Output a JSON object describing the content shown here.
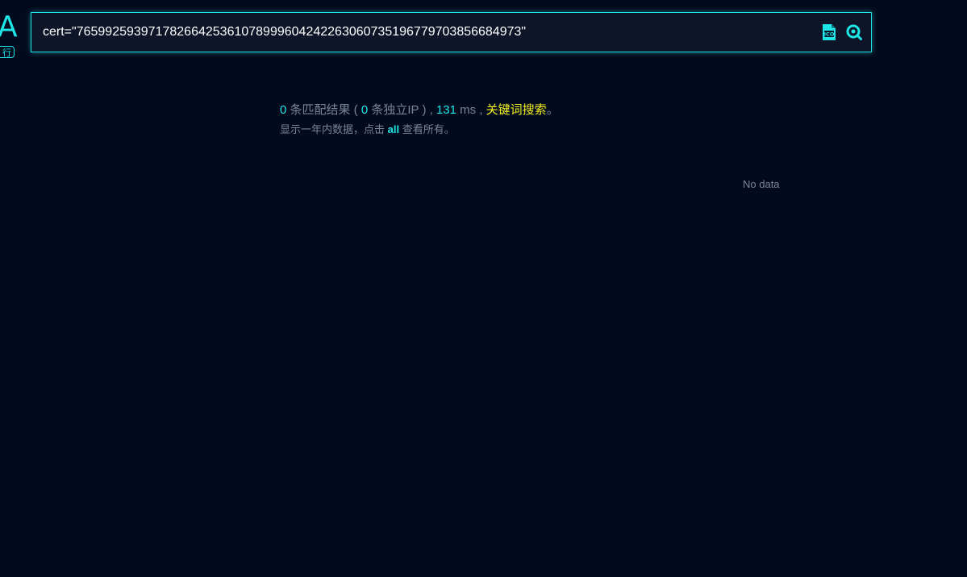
{
  "logo": {
    "letter": "A",
    "badge": "行"
  },
  "search": {
    "query": "cert=\"7659925939717826642536107899960424226306073519677970385668497 3\"",
    "ico_icon": "ico-file-icon",
    "search_icon": "search-icon"
  },
  "results": {
    "match_count": "0",
    "match_label": "条匹配结果 (",
    "ip_count": "0",
    "ip_label": "条独立IP ) ,",
    "time": "131",
    "time_unit": "ms ,",
    "keyword_search": "关键词搜索",
    "end_punct": "。",
    "note_before": "显示一年内数据，点击",
    "note_link": "all",
    "note_after": "查看所有。"
  },
  "empty": {
    "no_data": "No data"
  },
  "colors": {
    "accent": "#1ee6e6",
    "highlight": "#f5f01e",
    "background": "#020b1e",
    "muted": "#7b8598"
  }
}
